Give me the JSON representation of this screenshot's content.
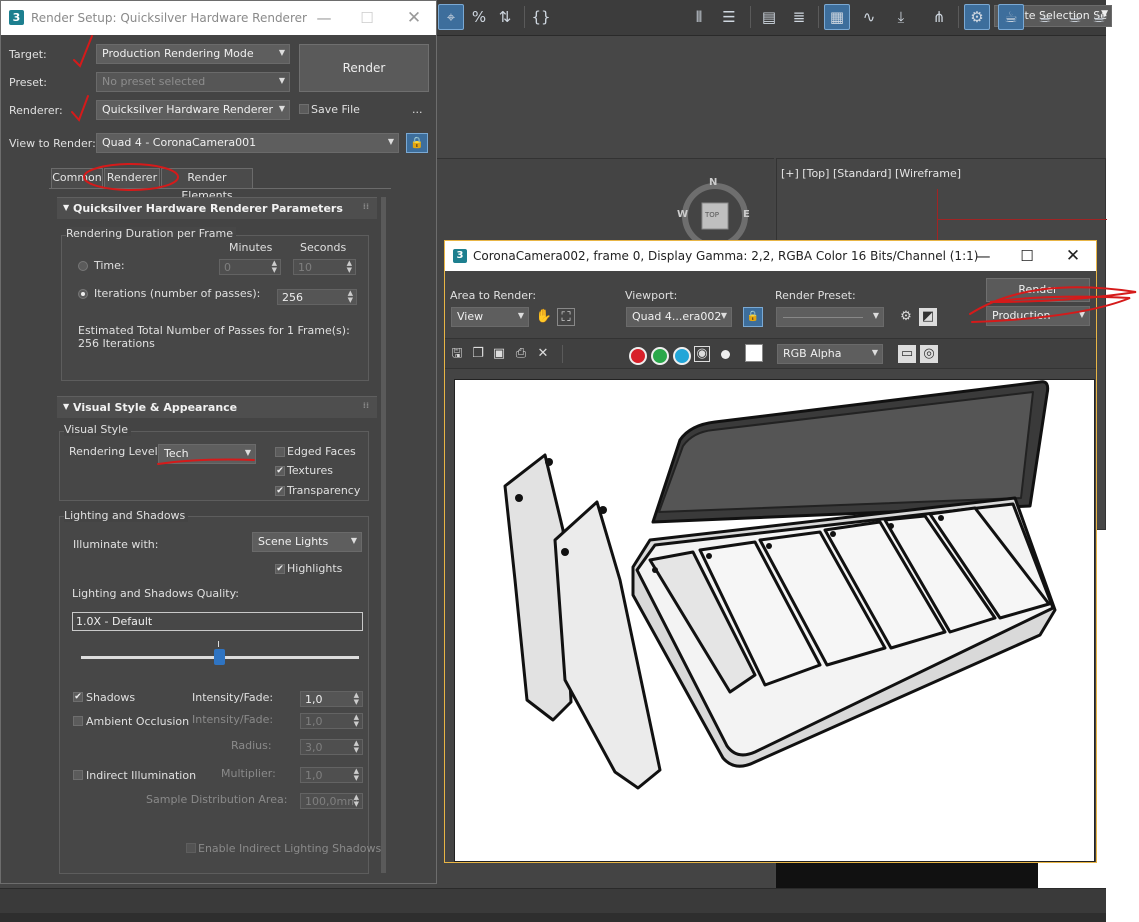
{
  "toolbar": {
    "selection_set_placeholder": "Create Selection Se"
  },
  "viewport_top": {
    "label": "[+] [Top] [Standard] [Wireframe]"
  },
  "viewcube": {
    "north": "N",
    "west": "W",
    "east": "E",
    "face": "TOP"
  },
  "render_setup": {
    "title": "Render Setup: Quicksilver Hardware Renderer",
    "logo": "3",
    "target_label": "Target:",
    "target_value": "Production Rendering Mode",
    "preset_label": "Preset:",
    "preset_value": "No preset selected",
    "renderer_label": "Renderer:",
    "renderer_value": "Quicksilver Hardware Renderer",
    "save_file_label": "Save File",
    "more_label": "...",
    "render_button": "Render",
    "view_label": "View to Render:",
    "view_value": "Quad 4 - CoronaCamera001",
    "tabs": [
      "Common",
      "Renderer",
      "Render Elements"
    ],
    "qs_params": {
      "header": "Quicksilver Hardware Renderer Parameters",
      "duration_group": "Rendering Duration per Frame",
      "minutes_header": "Minutes",
      "seconds_header": "Seconds",
      "time_label": "Time:",
      "time_minutes": "0",
      "time_seconds": "10",
      "iterations_label": "Iterations (number of passes):",
      "iterations_value": "256",
      "estimate_line1": "Estimated Total Number of Passes for 1 Frame(s):",
      "estimate_line2": "256 Iterations"
    },
    "visual": {
      "header": "Visual Style & Appearance",
      "group": "Visual Style",
      "rendering_level_label": "Rendering Level",
      "rendering_level_value": "Tech",
      "edged_faces": "Edged Faces",
      "textures": "Textures",
      "transparency": "Transparency",
      "lighting_group": "Lighting and Shadows",
      "illuminate_label": "Illuminate with:",
      "illuminate_value": "Scene Lights",
      "highlights": "Highlights",
      "quality_label": "Lighting and Shadows Quality:",
      "quality_value": "1.0X - Default",
      "shadows": "Shadows",
      "intensity_label": "Intensity/Fade:",
      "intensity_value": "1,0",
      "ao": "Ambient Occlusion",
      "ao_intensity_label": "Intensity/Fade:",
      "ao_intensity_value": "1,0",
      "radius_label": "Radius:",
      "radius_value": "3,0",
      "indirect": "Indirect Illumination",
      "multiplier_label": "Multiplier:",
      "multiplier_value": "1,0",
      "sample_label": "Sample Distribution Area:",
      "sample_value": "100,0mm",
      "enable_indirect": "Enable Indirect Lighting Shadows"
    }
  },
  "frame_buffer": {
    "title": "CoronaCamera002, frame 0, Display Gamma: 2,2, RGBA Color 16 Bits/Channel (1:1)",
    "logo": "3",
    "area_label": "Area to Render:",
    "area_value": "View",
    "viewport_label": "Viewport:",
    "viewport_value": "Quad 4...era002",
    "preset_label": "Render Preset:",
    "preset_value": "",
    "render_button": "Render",
    "production_value": "Production",
    "channel_value": "RGB Alpha"
  },
  "colors": {
    "accent": "#3d6e9c",
    "frame_border": "#e8b545",
    "annotation_red": "#d51a1a",
    "slider_knob": "#2f74c2"
  }
}
